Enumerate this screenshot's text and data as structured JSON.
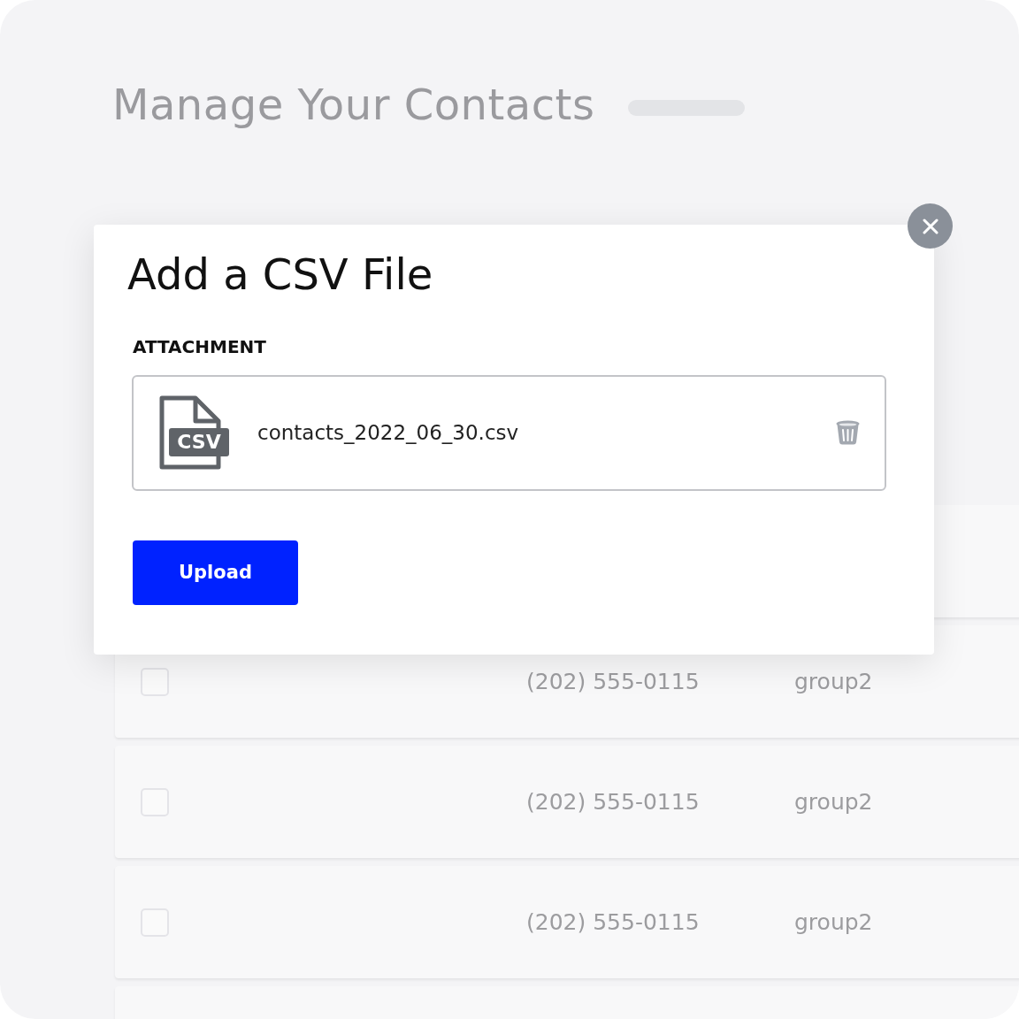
{
  "page": {
    "title": "Manage Your Contacts"
  },
  "contacts": [
    {
      "checked": false,
      "phone": "(202) 555-0115",
      "group": "group2"
    },
    {
      "checked": false,
      "phone": "(202) 555-0115",
      "group": "group2"
    },
    {
      "checked": false,
      "phone": "(202) 555-0115",
      "group": "group2"
    }
  ],
  "dialog": {
    "title": "Add a CSV File",
    "section_label": "ATTACHMENT",
    "file": {
      "icon_label": "CSV",
      "name": "contacts_2022_06_30.csv"
    },
    "button": "Upload"
  }
}
